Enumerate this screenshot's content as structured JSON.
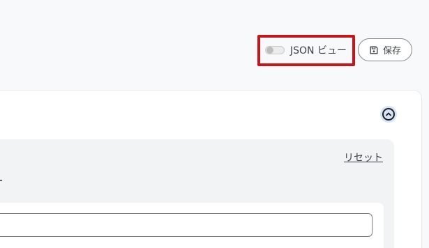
{
  "toolbar": {
    "json_view_label": "JSON ビュー",
    "json_view_on": false,
    "save_label": "保存",
    "highlight_color": "#c5161d"
  },
  "card": {
    "collapse_icon": "chevron-up-circle-icon",
    "reset_label": "リセット",
    "input_value": ""
  }
}
